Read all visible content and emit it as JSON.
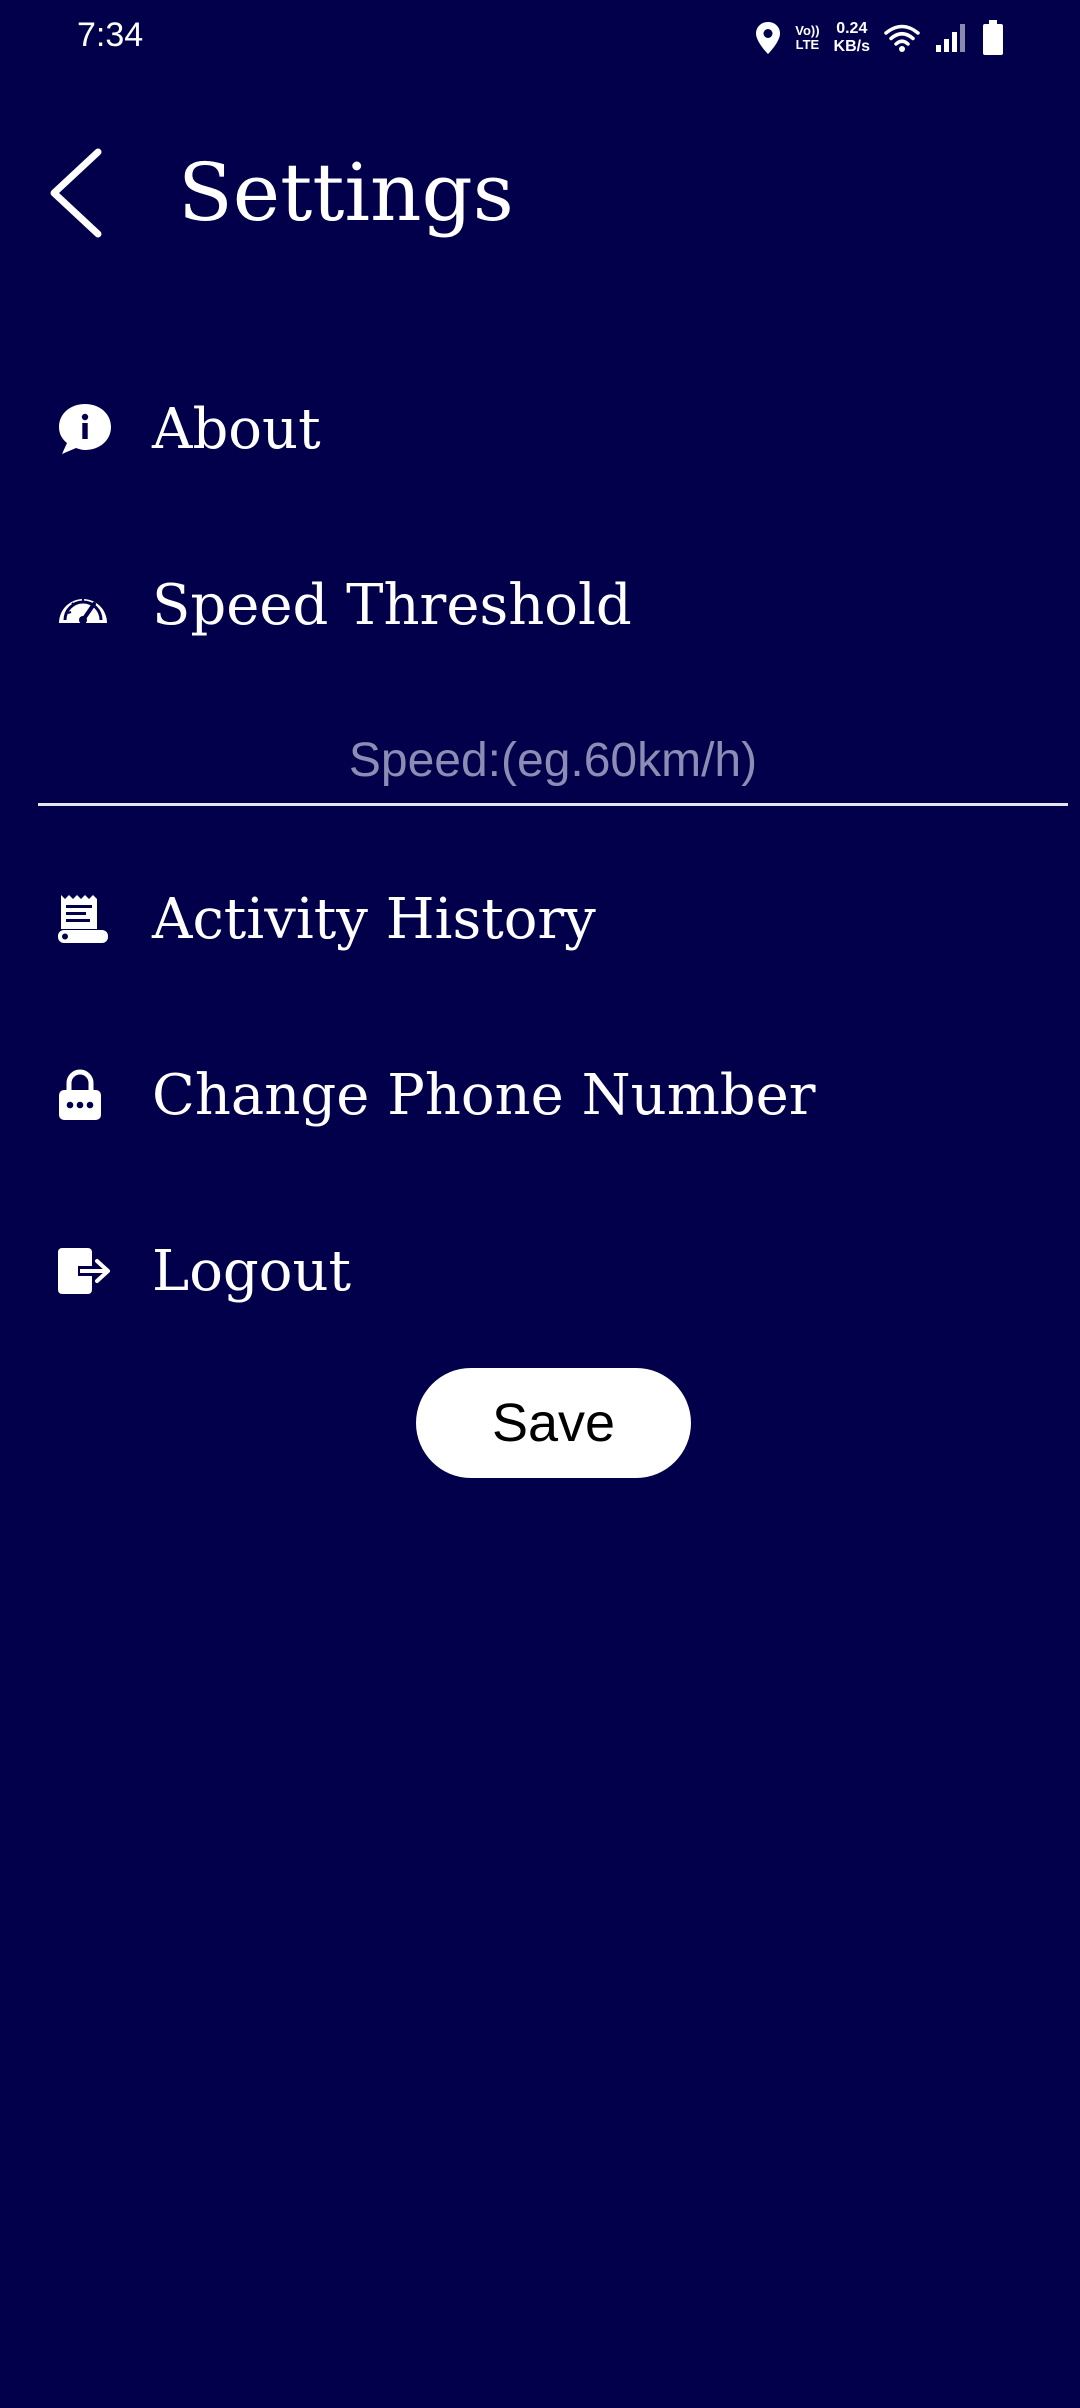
{
  "status_bar": {
    "time": "7:34",
    "volte_line1": "Vo))",
    "volte_line2": "LTE",
    "net_speed_value": "0.24",
    "net_speed_unit": "KB/s",
    "icons": [
      "location-icon",
      "volte-icon",
      "wifi-icon",
      "signal-icon",
      "battery-icon"
    ]
  },
  "header": {
    "title": "Settings",
    "back_icon": "chevron-left-icon"
  },
  "menu": {
    "about": {
      "label": "About",
      "icon": "info-bubble-icon"
    },
    "speed_threshold": {
      "label": "Speed Threshold",
      "icon": "speedometer-icon"
    },
    "activity_history": {
      "label": "Activity History",
      "icon": "receipt-history-icon"
    },
    "change_phone": {
      "label": "Change Phone Number",
      "icon": "password-lock-icon"
    },
    "logout": {
      "label": "Logout",
      "icon": "logout-icon"
    }
  },
  "speed_input": {
    "value": "",
    "placeholder": "Speed:(eg.60km/h)"
  },
  "save_button": {
    "label": "Save"
  },
  "colors": {
    "background": "#02004a",
    "text": "#ffffff",
    "placeholder": "#8c8cb4",
    "button_bg": "#ffffff",
    "button_text": "#000000"
  }
}
